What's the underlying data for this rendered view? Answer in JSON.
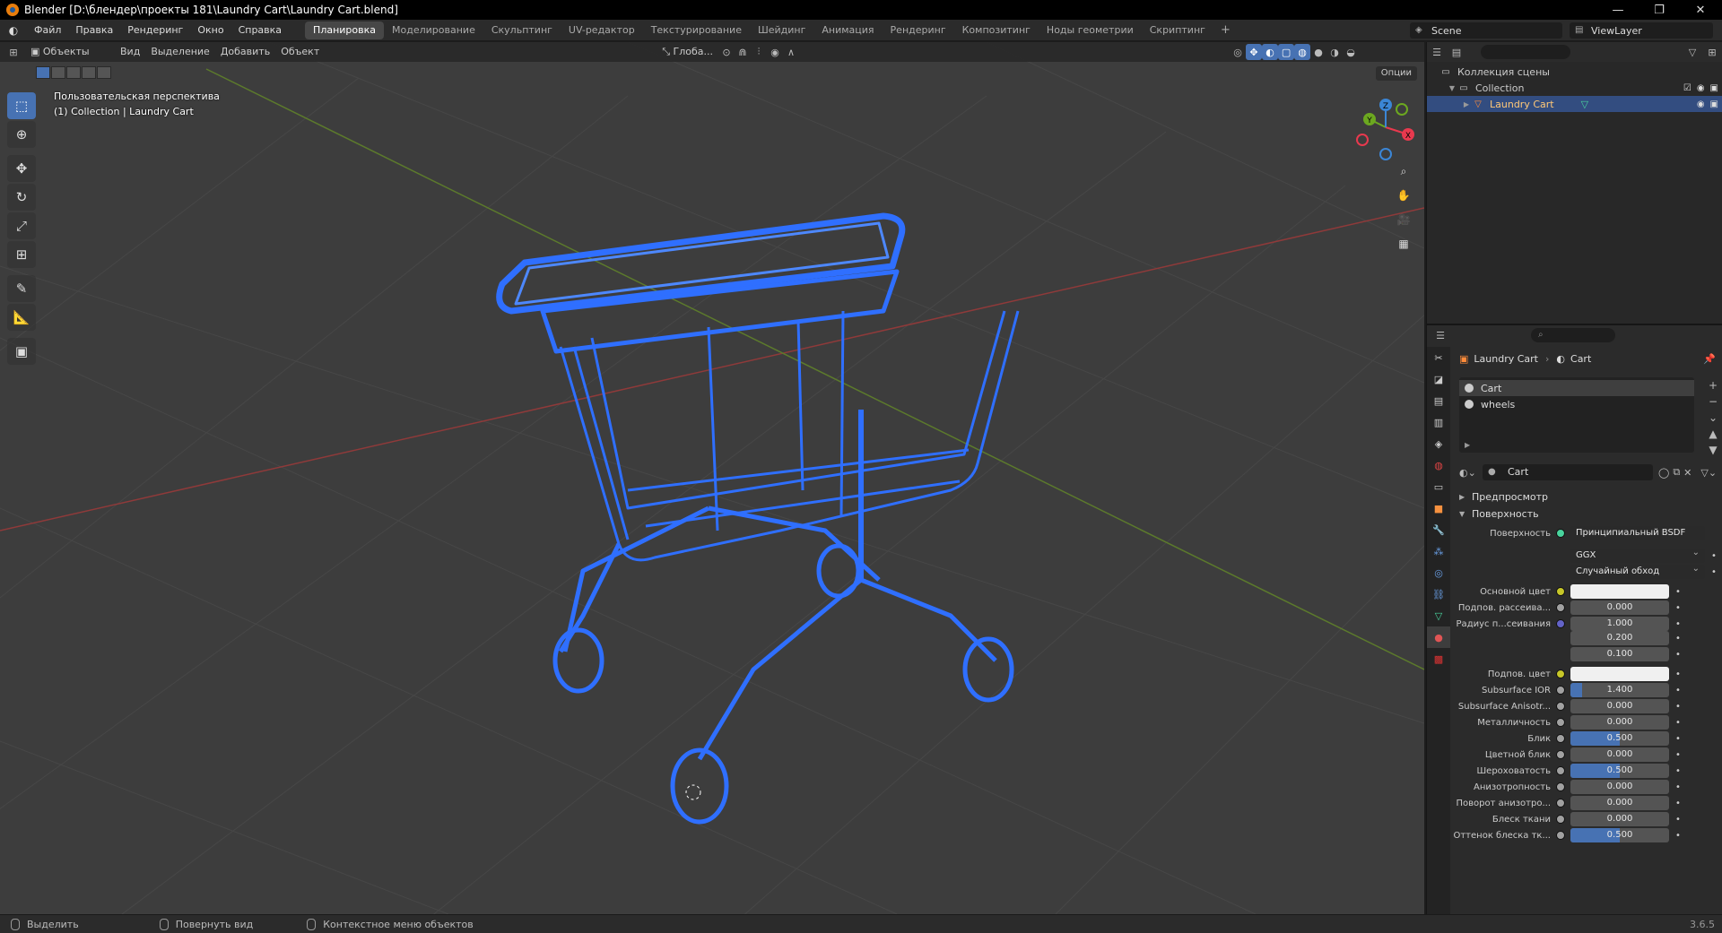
{
  "window": {
    "title": "Blender [D:\\блендер\\проекты 181\\Laundry Cart\\Laundry Cart.blend]",
    "controls": [
      "—",
      "❐",
      "✕"
    ]
  },
  "topbar": {
    "menus": [
      "Файл",
      "Правка",
      "Рендеринг",
      "Окно",
      "Справка"
    ],
    "workspaces": [
      "Планировка",
      "Моделирование",
      "Скульптинг",
      "UV-редактор",
      "Текстурирование",
      "Шейдинг",
      "Анимация",
      "Рендеринг",
      "Композитинг",
      "Ноды геометрии",
      "Скриптинг"
    ],
    "active_workspace": "Планировка",
    "plus": "+",
    "scene": "Scene",
    "view_layer": "ViewLayer"
  },
  "viewport": {
    "mode": "Объекты",
    "menus": [
      "Вид",
      "Выделение",
      "Добавить",
      "Объект"
    ],
    "transform_orientation": "Глоба...",
    "options": "Опции",
    "info_line1": "Пользовательская перспектива",
    "info_line2": "(1) Collection | Laundry Cart"
  },
  "gizmo": {
    "x": "X",
    "y": "Y",
    "z": "Z",
    "x_color": "#e8394e",
    "y_color": "#6ca820",
    "z_color": "#3b86d6"
  },
  "outliner": {
    "search_placeholder": "",
    "rows": [
      {
        "label": "Коллекция сцены",
        "icon": "scene-collection-icon"
      },
      {
        "label": "Collection",
        "icon": "collection-icon"
      },
      {
        "label": "Laundry Cart",
        "icon": "mesh-object-icon"
      }
    ]
  },
  "properties": {
    "breadcrumb_object": "Laundry Cart",
    "breadcrumb_material": "Cart",
    "slots": [
      "Cart",
      "wheels"
    ],
    "material_name": "Cart",
    "panel_preview": "Предпросмотр",
    "panel_surface": "Поверхность",
    "surface_label": "Поверхность",
    "surface_shader": "Принципиальный BSDF",
    "distribution": "GGX",
    "subsurface_method": "Случайный обход",
    "fields": [
      {
        "label": "Основной цвет",
        "value": "",
        "type": "color",
        "socket": "#c7c729"
      },
      {
        "label": "Подпов. рассеива...",
        "value": "0.000",
        "type": "num",
        "socket": "#a1a1a1"
      },
      {
        "label": "Радиус п...сеивания",
        "value": "1.000",
        "type": "num",
        "socket": "#6363c7"
      },
      {
        "label": "",
        "value": "0.200",
        "type": "num",
        "socket": ""
      },
      {
        "label": "",
        "value": "0.100",
        "type": "num",
        "socket": ""
      },
      {
        "label": "Подпов. цвет",
        "value": "",
        "type": "color",
        "socket": "#c7c729"
      },
      {
        "label": "Subsurface IOR",
        "value": "1.400",
        "type": "num",
        "fill": 0.12,
        "socket": "#a1a1a1"
      },
      {
        "label": "Subsurface Anisotr...",
        "value": "0.000",
        "type": "num",
        "socket": "#a1a1a1"
      },
      {
        "label": "Металличность",
        "value": "0.000",
        "type": "num",
        "socket": "#a1a1a1"
      },
      {
        "label": "Блик",
        "value": "0.500",
        "type": "num",
        "fill": 0.5,
        "socket": "#a1a1a1"
      },
      {
        "label": "Цветной блик",
        "value": "0.000",
        "type": "num",
        "socket": "#a1a1a1"
      },
      {
        "label": "Шероховатость",
        "value": "0.500",
        "type": "num",
        "fill": 0.5,
        "socket": "#a1a1a1"
      },
      {
        "label": "Анизотропность",
        "value": "0.000",
        "type": "num",
        "socket": "#a1a1a1"
      },
      {
        "label": "Поворот анизотро...",
        "value": "0.000",
        "type": "num",
        "socket": "#a1a1a1"
      },
      {
        "label": "Блеск ткани",
        "value": "0.000",
        "type": "num",
        "socket": "#a1a1a1"
      },
      {
        "label": "Оттенок блеска тк...",
        "value": "0.500",
        "type": "num",
        "fill": 0.5,
        "socket": "#a1a1a1"
      }
    ]
  },
  "statusbar": {
    "select": "Выделить",
    "rotate": "Повернуть вид",
    "context": "Контекстное меню объектов",
    "version": "3.6.5"
  },
  "colors": {
    "accent": "#4772b3",
    "wire": "#2f6fff",
    "viewport_bg": "#3d3d3d"
  }
}
